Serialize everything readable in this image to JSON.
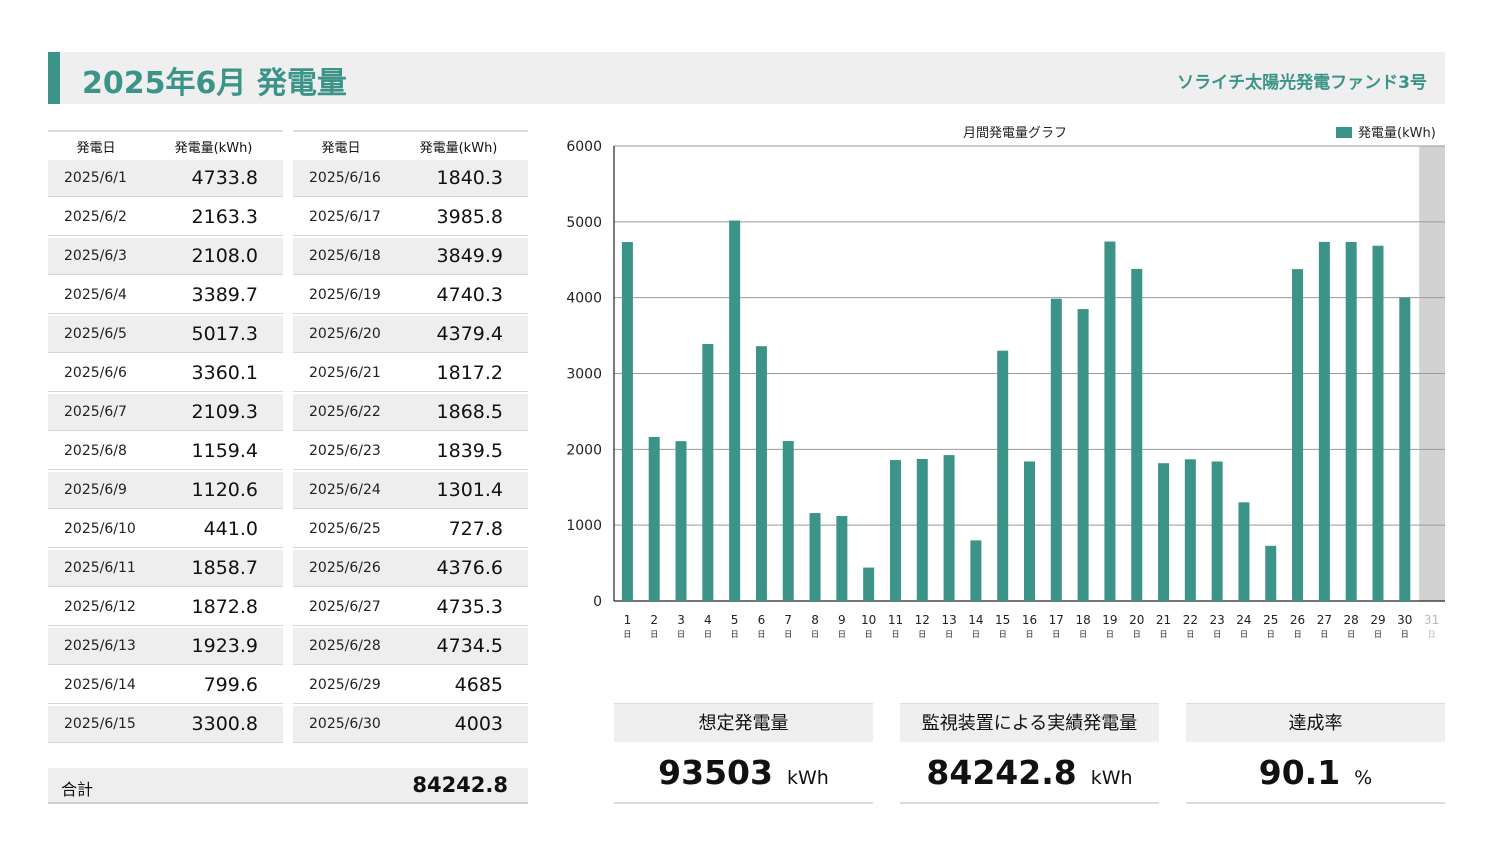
{
  "header": {
    "title": "2025年6月 発電量",
    "fund_name": "ソライチ太陽光発電ファンド3号"
  },
  "table": {
    "col_date": "発電日",
    "col_value": "発電量(kWh)",
    "rows": [
      {
        "date": "2025/6/1",
        "value": "4733.8"
      },
      {
        "date": "2025/6/2",
        "value": "2163.3"
      },
      {
        "date": "2025/6/3",
        "value": "2108.0"
      },
      {
        "date": "2025/6/4",
        "value": "3389.7"
      },
      {
        "date": "2025/6/5",
        "value": "5017.3"
      },
      {
        "date": "2025/6/6",
        "value": "3360.1"
      },
      {
        "date": "2025/6/7",
        "value": "2109.3"
      },
      {
        "date": "2025/6/8",
        "value": "1159.4"
      },
      {
        "date": "2025/6/9",
        "value": "1120.6"
      },
      {
        "date": "2025/6/10",
        "value": "441.0"
      },
      {
        "date": "2025/6/11",
        "value": "1858.7"
      },
      {
        "date": "2025/6/12",
        "value": "1872.8"
      },
      {
        "date": "2025/6/13",
        "value": "1923.9"
      },
      {
        "date": "2025/6/14",
        "value": "799.6"
      },
      {
        "date": "2025/6/15",
        "value": "3300.8"
      },
      {
        "date": "2025/6/16",
        "value": "1840.3"
      },
      {
        "date": "2025/6/17",
        "value": "3985.8"
      },
      {
        "date": "2025/6/18",
        "value": "3849.9"
      },
      {
        "date": "2025/6/19",
        "value": "4740.3"
      },
      {
        "date": "2025/6/20",
        "value": "4379.4"
      },
      {
        "date": "2025/6/21",
        "value": "1817.2"
      },
      {
        "date": "2025/6/22",
        "value": "1868.5"
      },
      {
        "date": "2025/6/23",
        "value": "1839.5"
      },
      {
        "date": "2025/6/24",
        "value": "1301.4"
      },
      {
        "date": "2025/6/25",
        "value": "727.8"
      },
      {
        "date": "2025/6/26",
        "value": "4376.6"
      },
      {
        "date": "2025/6/27",
        "value": "4735.3"
      },
      {
        "date": "2025/6/28",
        "value": "4734.5"
      },
      {
        "date": "2025/6/29",
        "value": "4685"
      },
      {
        "date": "2025/6/30",
        "value": "4003"
      }
    ],
    "total_label": "合計",
    "total_value": "84242.8"
  },
  "kpis": [
    {
      "label": "想定発電量",
      "value": "93503",
      "unit": "kWh"
    },
    {
      "label": "監視装置による実績発電量",
      "value": "84242.8",
      "unit": "kWh"
    },
    {
      "label": "達成率",
      "value": "90.1",
      "unit": "%"
    }
  ],
  "chart_data": {
    "type": "bar",
    "title": "月間発電量グラフ",
    "ylim": [
      0,
      6000
    ],
    "yticks": [
      0,
      1000,
      2000,
      3000,
      4000,
      5000,
      6000
    ],
    "grid": true,
    "legend_position": "top-right",
    "categories": [
      "1",
      "2",
      "3",
      "4",
      "5",
      "6",
      "7",
      "8",
      "9",
      "10",
      "11",
      "12",
      "13",
      "14",
      "15",
      "16",
      "17",
      "18",
      "19",
      "20",
      "21",
      "22",
      "23",
      "24",
      "25",
      "26",
      "27",
      "28",
      "29",
      "30",
      "31"
    ],
    "category_suffix": "日",
    "series": [
      {
        "name": "発電量(kWh)",
        "color": "#3c9489",
        "values": [
          4733.8,
          2163.3,
          2108.0,
          3389.7,
          5017.3,
          3360.1,
          2109.3,
          1159.4,
          1120.6,
          441.0,
          1858.7,
          1872.8,
          1923.9,
          799.6,
          3300.8,
          1840.3,
          3985.8,
          3849.9,
          4740.3,
          4379.4,
          1817.2,
          1868.5,
          1839.5,
          1301.4,
          727.8,
          4376.6,
          4735.3,
          4734.5,
          4685,
          4003,
          null
        ]
      }
    ],
    "inactive_categories": [
      "31"
    ]
  }
}
